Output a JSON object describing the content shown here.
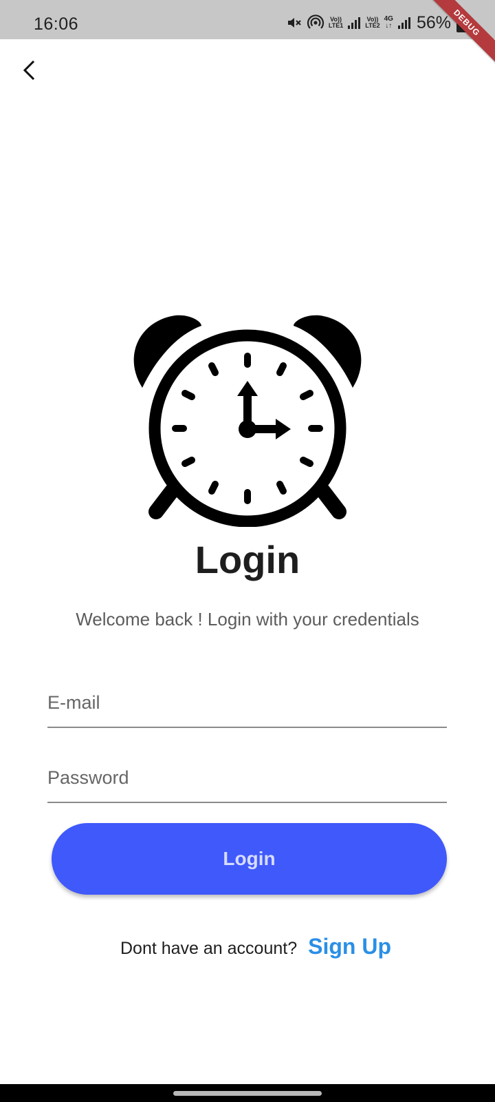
{
  "status_bar": {
    "time": "16:06",
    "sim1_label": "Vo))\nLTE1",
    "sim2_label": "Vo))\nLTE2",
    "network_type": "4G",
    "battery": "56%",
    "icons": [
      "mute-icon",
      "hotspot-icon",
      "signal-icon",
      "signal-icon",
      "battery-icon"
    ]
  },
  "debug_banner": "DEBUG",
  "header": {
    "back_icon": "chevron-left-icon"
  },
  "logo": {
    "icon": "alarm-clock-icon"
  },
  "login": {
    "title": "Login",
    "subtitle": "Welcome back ! Login with your credentials",
    "email": {
      "placeholder": "E-mail",
      "value": ""
    },
    "password": {
      "placeholder": "Password",
      "value": ""
    },
    "submit_label": "Login",
    "signup_prompt": "Dont have an account?",
    "signup_link": "Sign Up"
  },
  "colors": {
    "accent": "#4059fb",
    "link": "#2a8fe6",
    "status_bar": "#c7c7c7",
    "debug_banner": "#b43a3d"
  }
}
